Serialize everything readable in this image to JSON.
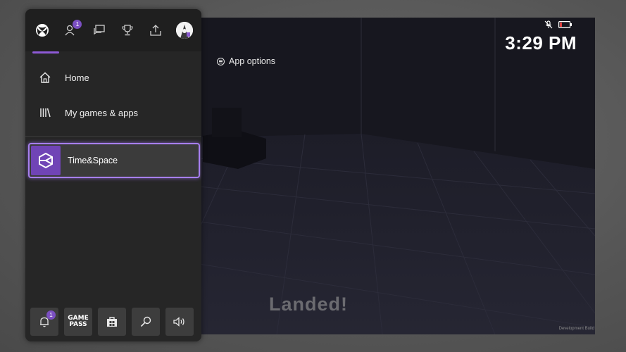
{
  "app_options": {
    "label": "App options"
  },
  "clock": {
    "time": "3:29 PM"
  },
  "game": {
    "status_text": "Landed!",
    "build_label": "Development Build"
  },
  "guide": {
    "tabs": [
      {
        "name": "xbox-icon"
      },
      {
        "name": "people-icon",
        "badge": "1"
      },
      {
        "name": "chat-icon"
      },
      {
        "name": "trophy-icon"
      },
      {
        "name": "share-icon"
      },
      {
        "name": "profile-avatar"
      }
    ],
    "menu": [
      {
        "label": "Home",
        "icon": "home-icon"
      },
      {
        "label": "My games & apps",
        "icon": "library-icon"
      }
    ],
    "current_app": {
      "label": "Time&Space",
      "icon": "unity-icon"
    },
    "bottom": {
      "notifications_badge": "1",
      "gamepass_line1": "GAME",
      "gamepass_line2": "PASS"
    }
  },
  "colors": {
    "accent": "#8e5ad6",
    "tile_border": "#a77ff0",
    "battery": "#e04040"
  }
}
